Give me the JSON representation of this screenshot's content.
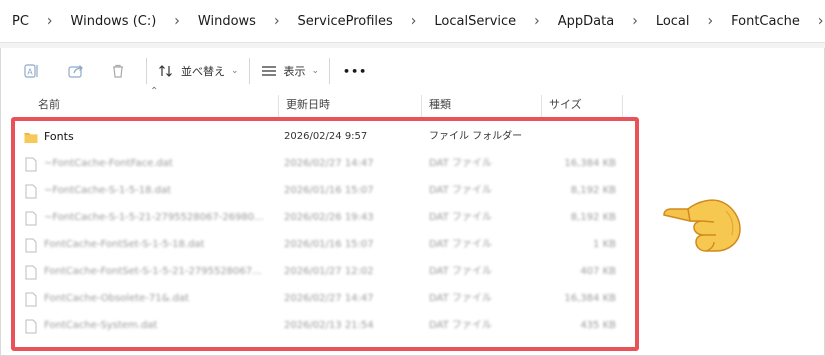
{
  "breadcrumb": [
    "PC",
    "Windows (C:)",
    "Windows",
    "ServiceProfiles",
    "LocalService",
    "AppData",
    "Local",
    "FontCache"
  ],
  "toolbar": {
    "sort_label": "並べ替え",
    "view_label": "表示",
    "more_label": "•••"
  },
  "columns": {
    "name": "名前",
    "date": "更新日時",
    "type": "種類",
    "size": "サイズ"
  },
  "files": [
    {
      "name": "Fonts",
      "date": "2026/02/24 9:57",
      "type": "ファイル フォルダー",
      "size": "",
      "folder": true
    },
    {
      "name": "~FontCache-FontFace.dat",
      "date": "2026/02/27 14:47",
      "type": "DAT ファイル",
      "size": "16,384 KB"
    },
    {
      "name": "~FontCache-S-1-5-18.dat",
      "date": "2026/01/16 15:07",
      "type": "DAT ファイル",
      "size": "8,192 KB"
    },
    {
      "name": "~FontCache-S-1-5-21-2795528067-26980...",
      "date": "2026/02/26 19:43",
      "type": "DAT ファイル",
      "size": "8,192 KB"
    },
    {
      "name": "FontCache-FontSet-S-1-5-18.dat",
      "date": "2026/01/16 15:07",
      "type": "DAT ファイル",
      "size": "1 KB"
    },
    {
      "name": "FontCache-FontSet-S-1-5-21-2795528067...",
      "date": "2026/01/27 12:02",
      "type": "DAT ファイル",
      "size": "407 KB"
    },
    {
      "name": "FontCache-Obsolete-71&.dat",
      "date": "2026/02/27 14:47",
      "type": "DAT ファイル",
      "size": "16,384 KB"
    },
    {
      "name": "FontCache-System.dat",
      "date": "2026/02/13 21:54",
      "type": "DAT ファイル",
      "size": "435 KB"
    }
  ],
  "colors": {
    "highlight": "#e8535a",
    "folder": "#f0b73b"
  },
  "icons": [
    "rename-icon",
    "share-icon",
    "delete-icon",
    "sort-icon",
    "view-icon",
    "folder-icon",
    "file-icon",
    "pointing-hand-icon"
  ]
}
